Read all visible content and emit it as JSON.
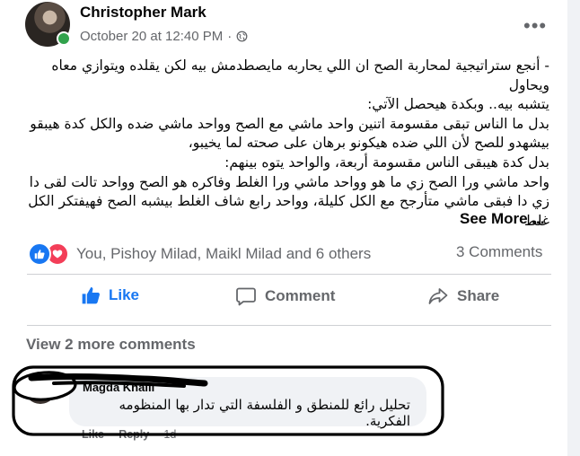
{
  "post": {
    "author": "Christopher Mark",
    "timestamp": "October 20 at 12:40 PM",
    "separator": "·",
    "privacy_icon": "globe-icon",
    "more_icon": "ellipsis-icon",
    "body_lines": [
      "- أنجع ستراتيجية لمحاربة الصح ان اللي يحاربه مايصطدمش بيه لكن يقلده ويتوازي معاه ويحاول",
      "يتشبه بيه.. وبكدة هيحصل الآتي:",
      "بدل ما الناس تبقى مقسومة اتنين واحد ماشي مع الصح وواحد ماشي ضده والكل كدة هيبقو",
      "بيشهدو للصح لأن اللي ضده هيكونو برهان على صحته لما يخيبو،",
      "بدل كدة هيبقى الناس مقسومة أربعة، والواحد يتوه بينهم:",
      "واحد ماشي ورا الصح زي ما هو وواحد ماشي ورا الغلط وفاكره هو الصح وواحد تالت لقى دا",
      "زي دا فبقى ماشي متأرجح مع الكل كليلة، وواحد رابع شاف الغلط بيشبه الصح فهيفتكر الكل غلط"
    ],
    "see_more": "See More ..."
  },
  "reactions": {
    "icons": [
      "like-reaction-icon",
      "love-reaction-icon"
    ],
    "reactors": "You, Pishoy Milad, Maikl Milad and 6 others",
    "comments_count": "3 Comments"
  },
  "actions": {
    "like": "Like",
    "comment": "Comment",
    "share": "Share"
  },
  "comments": {
    "view_more": "View 2 more comments",
    "items": [
      {
        "author": "Magda Khalil",
        "text": "تحليل رائع للمنطق و الفلسفة التي تدار بها المنظومه الفكرية.",
        "like": "Like",
        "reply": "Reply",
        "time": "1d"
      }
    ]
  },
  "colors": {
    "brand_blue": "#1877f2",
    "secondary_text": "#65676b",
    "love_red": "#f33e58",
    "online_green": "#31a24c",
    "bubble_bg": "#f0f2f5"
  }
}
